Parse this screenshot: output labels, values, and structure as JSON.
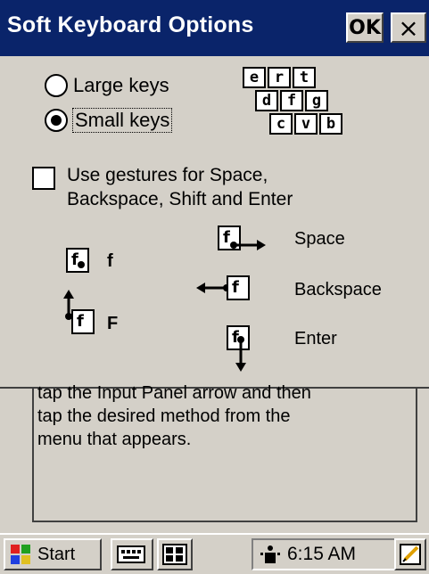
{
  "window": {
    "title": "Soft Keyboard Options",
    "ok_label": "OK",
    "close_glyph": "×"
  },
  "options": {
    "key_size": [
      {
        "label": "Large keys",
        "selected": false
      },
      {
        "label": "Small keys",
        "selected": true
      }
    ],
    "gestures": {
      "label_line1": "Use gestures for Space,",
      "label_line2": "Backspace, Shift and Enter",
      "checked": false
    }
  },
  "keyboard_preview": {
    "row1": [
      "e",
      "r",
      "t"
    ],
    "row2": [
      "d",
      "f",
      "g"
    ],
    "row3": [
      "c",
      "v",
      "b"
    ]
  },
  "gesture_demo": {
    "tap": {
      "key": "f",
      "result": "f"
    },
    "shift": {
      "key": "f",
      "result": "F"
    },
    "space": {
      "key": "f",
      "label": "Space"
    },
    "backspace": {
      "key": "f",
      "label": "Backspace"
    },
    "enter": {
      "key": "f",
      "label": "Enter"
    }
  },
  "help_text": {
    "line1": "tap the Input Panel arrow and then",
    "line2": "tap the desired method from the",
    "line3": "menu that appears."
  },
  "taskbar": {
    "start_label": "Start",
    "time": "6:15 AM"
  }
}
